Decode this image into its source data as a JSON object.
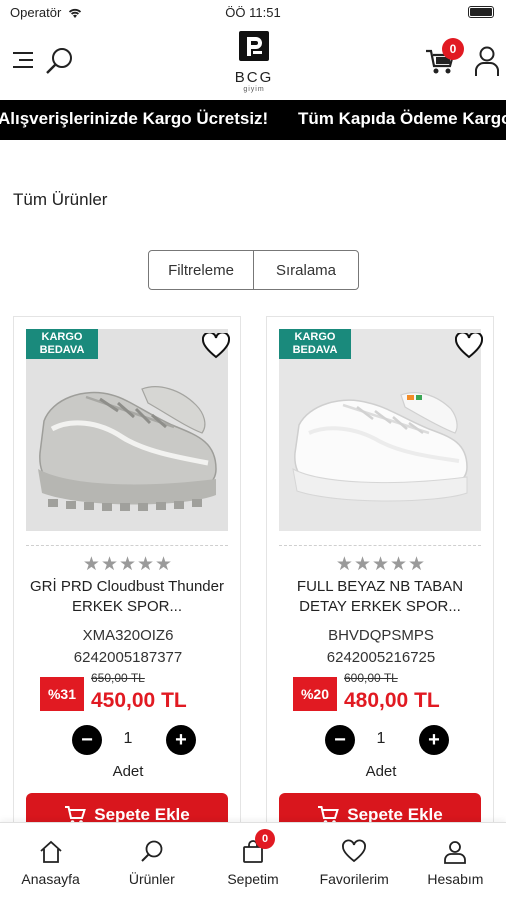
{
  "status_bar": {
    "carrier": "Operatör",
    "time": "ÖÖ 11:51"
  },
  "header": {
    "brand": "BCG",
    "brand_sub": "giyim",
    "cart_count": "0"
  },
  "marquee": {
    "items": [
      "Alışverişlerinizde Kargo Ücretsiz!",
      "Tüm Kapıda Ödeme Kargo"
    ]
  },
  "page_title": "Tüm Ürünler",
  "controls": {
    "filter_label": "Filtreleme",
    "sort_label": "Sıralama"
  },
  "products": [
    {
      "badge": "KARGO BEDAVA",
      "stars": "★★★★★",
      "name": "GRİ PRD Cloudbust Thunder ERKEK SPOR...",
      "code": "XMA320OIZ6",
      "barcode": "6242005187377",
      "discount": "%31",
      "old_price": "650,00 TL",
      "price": "450,00 TL",
      "qty": "1",
      "unit": "Adet",
      "add_label": "Sepete Ekle",
      "rating": 0
    },
    {
      "badge": "KARGO BEDAVA",
      "stars": "★★★★★",
      "name": "FULL BEYAZ NB TABAN DETAY ERKEK SPOR...",
      "code": "BHVDQPSMPS",
      "barcode": "6242005216725",
      "discount": "%20",
      "old_price": "600,00 TL",
      "price": "480,00 TL",
      "qty": "1",
      "unit": "Adet",
      "add_label": "Sepete Ekle",
      "rating": 0
    }
  ],
  "tabs": [
    {
      "label": "Anasayfa",
      "icon": "home-icon"
    },
    {
      "label": "Ürünler",
      "icon": "search-icon"
    },
    {
      "label": "Sepetim",
      "icon": "bag-icon",
      "badge": "0"
    },
    {
      "label": "Favorilerim",
      "icon": "heart-icon"
    },
    {
      "label": "Hesabım",
      "icon": "user-icon"
    }
  ],
  "colors": {
    "accent_red": "#e11a22",
    "kargo_green": "#1a8a7c",
    "marquee_bg": "#000000"
  }
}
